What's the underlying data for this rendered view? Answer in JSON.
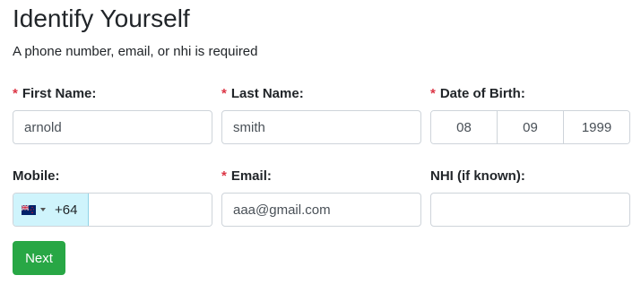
{
  "form": {
    "title": "Identify Yourself",
    "subtitle": "A phone number, email, or nhi is required",
    "required_marker": "*",
    "first_name": {
      "label": "First Name:",
      "value": "arnold"
    },
    "last_name": {
      "label": "Last Name:",
      "value": "smith"
    },
    "dob": {
      "label": "Date of Birth:",
      "day": "08",
      "month": "09",
      "year": "1999"
    },
    "mobile": {
      "label": "Mobile:",
      "country_flag": "new-zealand-flag-icon",
      "dial_code": "+64",
      "value": ""
    },
    "email": {
      "label": "Email:",
      "value": "aaa@gmail.com"
    },
    "nhi": {
      "label": "NHI (if known):",
      "value": ""
    },
    "next_label": "Next"
  },
  "colors": {
    "required": "#dc3545",
    "primary_button": "#28a745",
    "country_select_bg": "#cff4fc"
  }
}
